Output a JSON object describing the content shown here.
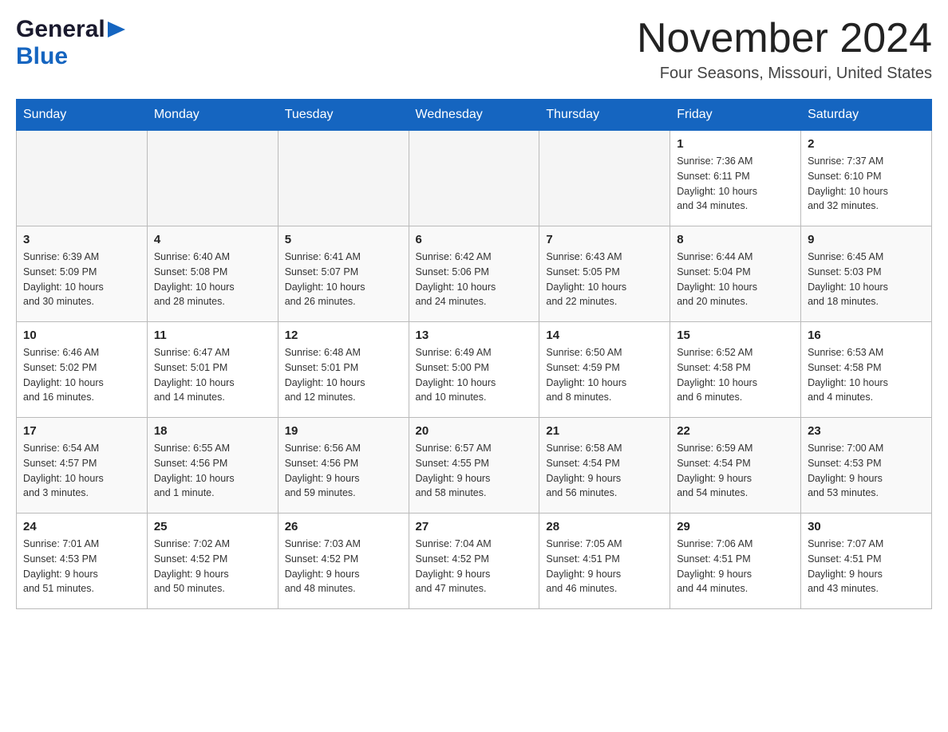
{
  "header": {
    "logo_general": "General",
    "logo_blue": "Blue",
    "title": "November 2024",
    "location": "Four Seasons, Missouri, United States"
  },
  "weekdays": [
    "Sunday",
    "Monday",
    "Tuesday",
    "Wednesday",
    "Thursday",
    "Friday",
    "Saturday"
  ],
  "weeks": [
    [
      {
        "day": "",
        "info": ""
      },
      {
        "day": "",
        "info": ""
      },
      {
        "day": "",
        "info": ""
      },
      {
        "day": "",
        "info": ""
      },
      {
        "day": "",
        "info": ""
      },
      {
        "day": "1",
        "info": "Sunrise: 7:36 AM\nSunset: 6:11 PM\nDaylight: 10 hours\nand 34 minutes."
      },
      {
        "day": "2",
        "info": "Sunrise: 7:37 AM\nSunset: 6:10 PM\nDaylight: 10 hours\nand 32 minutes."
      }
    ],
    [
      {
        "day": "3",
        "info": "Sunrise: 6:39 AM\nSunset: 5:09 PM\nDaylight: 10 hours\nand 30 minutes."
      },
      {
        "day": "4",
        "info": "Sunrise: 6:40 AM\nSunset: 5:08 PM\nDaylight: 10 hours\nand 28 minutes."
      },
      {
        "day": "5",
        "info": "Sunrise: 6:41 AM\nSunset: 5:07 PM\nDaylight: 10 hours\nand 26 minutes."
      },
      {
        "day": "6",
        "info": "Sunrise: 6:42 AM\nSunset: 5:06 PM\nDaylight: 10 hours\nand 24 minutes."
      },
      {
        "day": "7",
        "info": "Sunrise: 6:43 AM\nSunset: 5:05 PM\nDaylight: 10 hours\nand 22 minutes."
      },
      {
        "day": "8",
        "info": "Sunrise: 6:44 AM\nSunset: 5:04 PM\nDaylight: 10 hours\nand 20 minutes."
      },
      {
        "day": "9",
        "info": "Sunrise: 6:45 AM\nSunset: 5:03 PM\nDaylight: 10 hours\nand 18 minutes."
      }
    ],
    [
      {
        "day": "10",
        "info": "Sunrise: 6:46 AM\nSunset: 5:02 PM\nDaylight: 10 hours\nand 16 minutes."
      },
      {
        "day": "11",
        "info": "Sunrise: 6:47 AM\nSunset: 5:01 PM\nDaylight: 10 hours\nand 14 minutes."
      },
      {
        "day": "12",
        "info": "Sunrise: 6:48 AM\nSunset: 5:01 PM\nDaylight: 10 hours\nand 12 minutes."
      },
      {
        "day": "13",
        "info": "Sunrise: 6:49 AM\nSunset: 5:00 PM\nDaylight: 10 hours\nand 10 minutes."
      },
      {
        "day": "14",
        "info": "Sunrise: 6:50 AM\nSunset: 4:59 PM\nDaylight: 10 hours\nand 8 minutes."
      },
      {
        "day": "15",
        "info": "Sunrise: 6:52 AM\nSunset: 4:58 PM\nDaylight: 10 hours\nand 6 minutes."
      },
      {
        "day": "16",
        "info": "Sunrise: 6:53 AM\nSunset: 4:58 PM\nDaylight: 10 hours\nand 4 minutes."
      }
    ],
    [
      {
        "day": "17",
        "info": "Sunrise: 6:54 AM\nSunset: 4:57 PM\nDaylight: 10 hours\nand 3 minutes."
      },
      {
        "day": "18",
        "info": "Sunrise: 6:55 AM\nSunset: 4:56 PM\nDaylight: 10 hours\nand 1 minute."
      },
      {
        "day": "19",
        "info": "Sunrise: 6:56 AM\nSunset: 4:56 PM\nDaylight: 9 hours\nand 59 minutes."
      },
      {
        "day": "20",
        "info": "Sunrise: 6:57 AM\nSunset: 4:55 PM\nDaylight: 9 hours\nand 58 minutes."
      },
      {
        "day": "21",
        "info": "Sunrise: 6:58 AM\nSunset: 4:54 PM\nDaylight: 9 hours\nand 56 minutes."
      },
      {
        "day": "22",
        "info": "Sunrise: 6:59 AM\nSunset: 4:54 PM\nDaylight: 9 hours\nand 54 minutes."
      },
      {
        "day": "23",
        "info": "Sunrise: 7:00 AM\nSunset: 4:53 PM\nDaylight: 9 hours\nand 53 minutes."
      }
    ],
    [
      {
        "day": "24",
        "info": "Sunrise: 7:01 AM\nSunset: 4:53 PM\nDaylight: 9 hours\nand 51 minutes."
      },
      {
        "day": "25",
        "info": "Sunrise: 7:02 AM\nSunset: 4:52 PM\nDaylight: 9 hours\nand 50 minutes."
      },
      {
        "day": "26",
        "info": "Sunrise: 7:03 AM\nSunset: 4:52 PM\nDaylight: 9 hours\nand 48 minutes."
      },
      {
        "day": "27",
        "info": "Sunrise: 7:04 AM\nSunset: 4:52 PM\nDaylight: 9 hours\nand 47 minutes."
      },
      {
        "day": "28",
        "info": "Sunrise: 7:05 AM\nSunset: 4:51 PM\nDaylight: 9 hours\nand 46 minutes."
      },
      {
        "day": "29",
        "info": "Sunrise: 7:06 AM\nSunset: 4:51 PM\nDaylight: 9 hours\nand 44 minutes."
      },
      {
        "day": "30",
        "info": "Sunrise: 7:07 AM\nSunset: 4:51 PM\nDaylight: 9 hours\nand 43 minutes."
      }
    ]
  ]
}
